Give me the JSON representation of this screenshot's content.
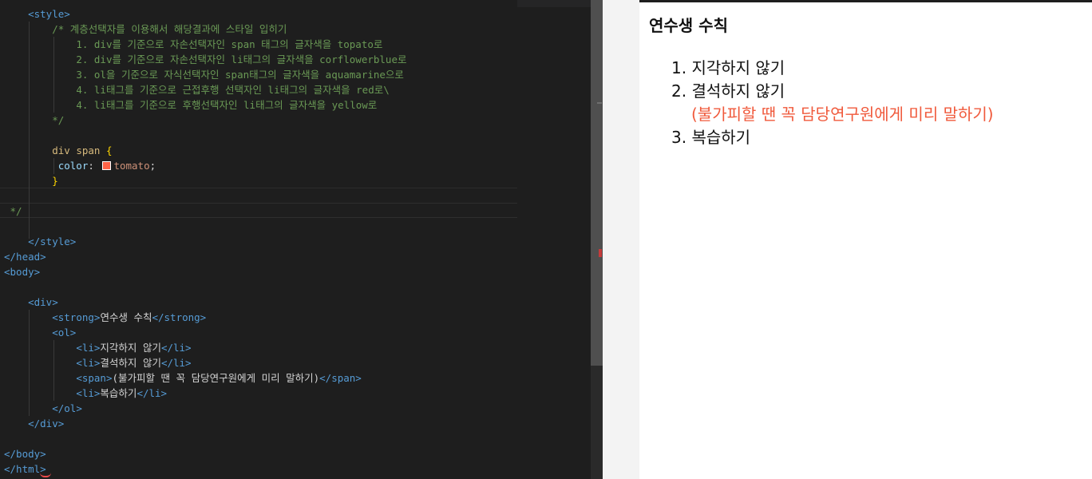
{
  "editor": {
    "code_lines": [
      {
        "indent": "    ",
        "segments": [
          {
            "c": "tag",
            "t": "<style>"
          }
        ]
      },
      {
        "indent": "        ",
        "segments": [
          {
            "c": "cmt",
            "t": "/* 계층선택자를 이용해서 해당결과에 스타일 입히기"
          }
        ]
      },
      {
        "indent": "            ",
        "segments": [
          {
            "c": "cmt",
            "t": "1. div를 기준으로 자손선택자인 span 태그의 글자색을 topato로"
          }
        ]
      },
      {
        "indent": "            ",
        "segments": [
          {
            "c": "cmt",
            "t": "2. div를 기준으로 자손선택자인 li태그의 글자색을 corflowerblue로"
          }
        ]
      },
      {
        "indent": "            ",
        "segments": [
          {
            "c": "cmt",
            "t": "3. ol을 기준으로 자식선택자인 span태그의 글자색을 aquamarine으로"
          }
        ]
      },
      {
        "indent": "            ",
        "segments": [
          {
            "c": "cmt",
            "t": "4. li태그를 기준으로 근접후행 선택자인 li태그의 글자색을 red로\\"
          }
        ]
      },
      {
        "indent": "            ",
        "segments": [
          {
            "c": "cmt",
            "t": "4. li태그를 기준으로 후행선택자인 li태그의 글자색을 yellow로"
          }
        ]
      },
      {
        "indent": "        ",
        "segments": [
          {
            "c": "cmt",
            "t": "*/"
          }
        ]
      },
      {
        "indent": "",
        "segments": []
      },
      {
        "indent": "        ",
        "segments": [
          {
            "c": "sel",
            "t": "div span "
          },
          {
            "c": "brace",
            "t": "{"
          }
        ]
      },
      {
        "indent": "         ",
        "segments": [
          {
            "c": "prop",
            "t": "color"
          },
          {
            "c": "punc",
            "t": ": "
          },
          {
            "c": "swatch",
            "t": ""
          },
          {
            "c": "val",
            "t": "tomato"
          },
          {
            "c": "punc",
            "t": ";"
          }
        ]
      },
      {
        "indent": "        ",
        "segments": [
          {
            "c": "brace",
            "t": "}"
          }
        ]
      },
      {
        "indent": "",
        "segments": []
      },
      {
        "indent": " ",
        "segments": [
          {
            "c": "cmt",
            "t": "*/"
          }
        ]
      },
      {
        "indent": "",
        "segments": []
      },
      {
        "indent": "    ",
        "segments": [
          {
            "c": "tag",
            "t": "</style>"
          }
        ]
      },
      {
        "indent": "",
        "segments": [
          {
            "c": "tag",
            "t": "</head>"
          }
        ]
      },
      {
        "indent": "",
        "segments": [
          {
            "c": "tag",
            "t": "<body>"
          }
        ]
      },
      {
        "indent": "",
        "segments": []
      },
      {
        "indent": "    ",
        "segments": [
          {
            "c": "tag",
            "t": "<div>"
          }
        ]
      },
      {
        "indent": "        ",
        "segments": [
          {
            "c": "tag",
            "t": "<strong>"
          },
          {
            "c": "txt",
            "t": "연수생 수칙"
          },
          {
            "c": "tag",
            "t": "</strong>"
          }
        ]
      },
      {
        "indent": "        ",
        "segments": [
          {
            "c": "tag",
            "t": "<ol>"
          }
        ]
      },
      {
        "indent": "            ",
        "segments": [
          {
            "c": "tag",
            "t": "<li>"
          },
          {
            "c": "txt",
            "t": "지각하지 않기"
          },
          {
            "c": "tag",
            "t": "</li>"
          }
        ]
      },
      {
        "indent": "            ",
        "segments": [
          {
            "c": "tag",
            "t": "<li>"
          },
          {
            "c": "txt",
            "t": "결석하지 않기"
          },
          {
            "c": "tag",
            "t": "</li>"
          }
        ]
      },
      {
        "indent": "            ",
        "segments": [
          {
            "c": "tag",
            "t": "<span>"
          },
          {
            "c": "txt",
            "t": "(불가피할 땐 꼭 담당연구원에게 미리 말하기)"
          },
          {
            "c": "tag",
            "t": "</span>"
          }
        ]
      },
      {
        "indent": "            ",
        "segments": [
          {
            "c": "tag",
            "t": "<li>"
          },
          {
            "c": "txt",
            "t": "복습하기"
          },
          {
            "c": "tag",
            "t": "</li>"
          }
        ]
      },
      {
        "indent": "        ",
        "segments": [
          {
            "c": "tag",
            "t": "</ol>"
          }
        ]
      },
      {
        "indent": "    ",
        "segments": [
          {
            "c": "tag",
            "t": "</div>"
          }
        ]
      },
      {
        "indent": "",
        "segments": []
      },
      {
        "indent": "",
        "segments": [
          {
            "c": "tag",
            "t": "</body>"
          }
        ]
      },
      {
        "indent": "",
        "segments": [
          {
            "c": "tag",
            "t": "</html>"
          }
        ]
      }
    ],
    "swatch_color": "#ff6347"
  },
  "preview": {
    "title": "연수생 수칙",
    "items": [
      {
        "marker": "1.",
        "text": "지각하지 않기"
      },
      {
        "marker": "2.",
        "text": "결석하지 않기"
      },
      {
        "marker": "3.",
        "text": "복습하기"
      }
    ],
    "note": "(불가피할 땐 꼭 담당연구원에게 미리 말하기)",
    "note_color": "#f05a3c"
  }
}
